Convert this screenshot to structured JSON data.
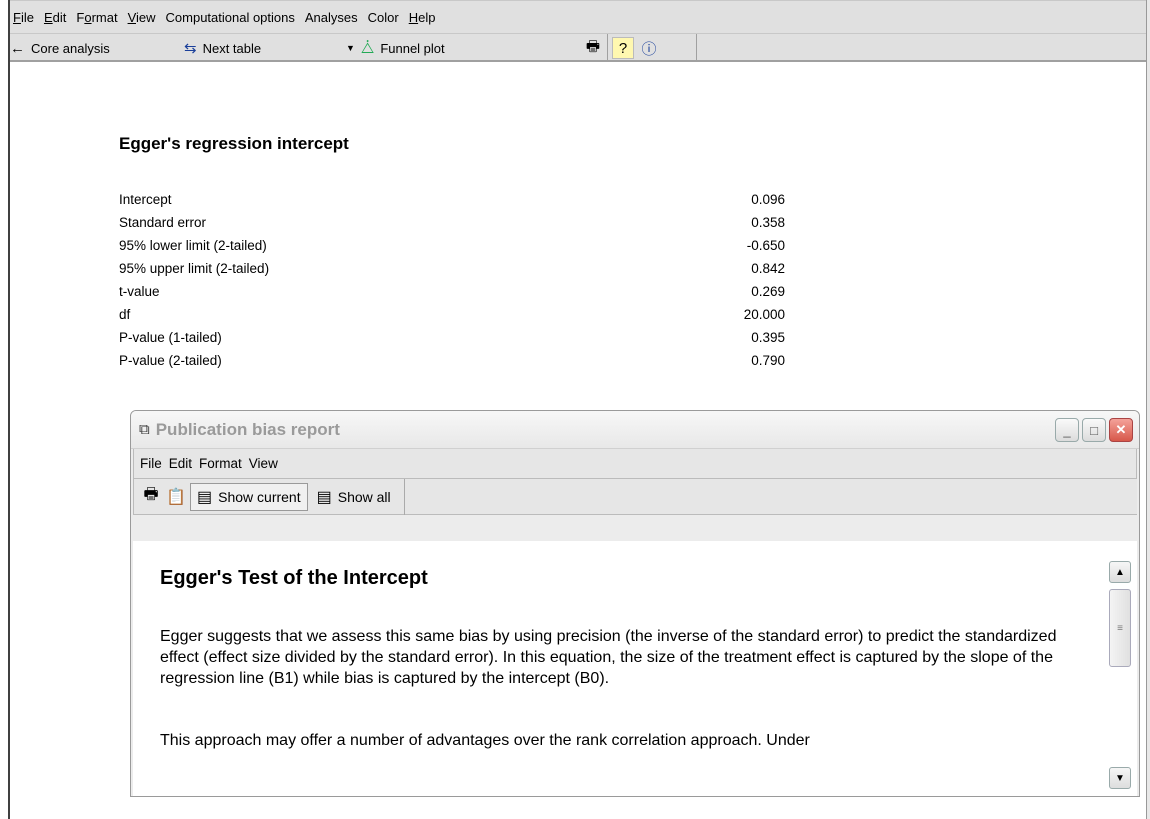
{
  "menubar": {
    "items": [
      {
        "label": "File",
        "u": "F"
      },
      {
        "label": "Edit",
        "u": "E"
      },
      {
        "label": "Format",
        "u": "o"
      },
      {
        "label": "View",
        "u": "V"
      },
      {
        "label": "Computational options",
        "u": ""
      },
      {
        "label": "Analyses",
        "u": ""
      },
      {
        "label": "Color",
        "u": ""
      },
      {
        "label": "Help",
        "u": "H"
      }
    ]
  },
  "toolbar": {
    "core_analysis": "Core analysis",
    "next_table": "Next table",
    "funnel_plot": "Funnel plot"
  },
  "report": {
    "title": "Egger's regression intercept",
    "stats": [
      {
        "label": "Intercept",
        "value": "0.096"
      },
      {
        "label": "Standard error",
        "value": "0.358"
      },
      {
        "label": "95% lower limit (2-tailed)",
        "value": "-0.650"
      },
      {
        "label": "95% upper limit (2-tailed)",
        "value": "0.842"
      },
      {
        "label": "t-value",
        "value": "0.269"
      },
      {
        "label": "df",
        "value": "20.000"
      },
      {
        "label": "P-value (1-tailed)",
        "value": "0.395"
      },
      {
        "label": "P-value (2-tailed)",
        "value": "0.790"
      }
    ]
  },
  "child_window": {
    "title": "Publication bias report",
    "menu": [
      "File",
      "Edit",
      "Format",
      "View"
    ],
    "toolbar": {
      "show_current": "Show current",
      "show_all": "Show all"
    },
    "content": {
      "heading": "Egger's Test of the Intercept",
      "paragraph1": "Egger suggests that we assess this same bias by using precision (the inverse of the standard error) to predict the standardized effect (effect size divided by the standard error).  In this equation, the size of the treatment effect is captured by the slope of the regression line (B1) while bias is captured by the intercept (B0).",
      "paragraph2": "This approach may offer a number of advantages over the rank correlation approach.  Under"
    }
  },
  "icons": {
    "back_arrow": "arrow-left-icon",
    "next_table": "next-table-icon",
    "funnel": "funnel-plot-icon",
    "print": "print-icon",
    "help": "help-pointer-icon",
    "info": "info-icon"
  }
}
